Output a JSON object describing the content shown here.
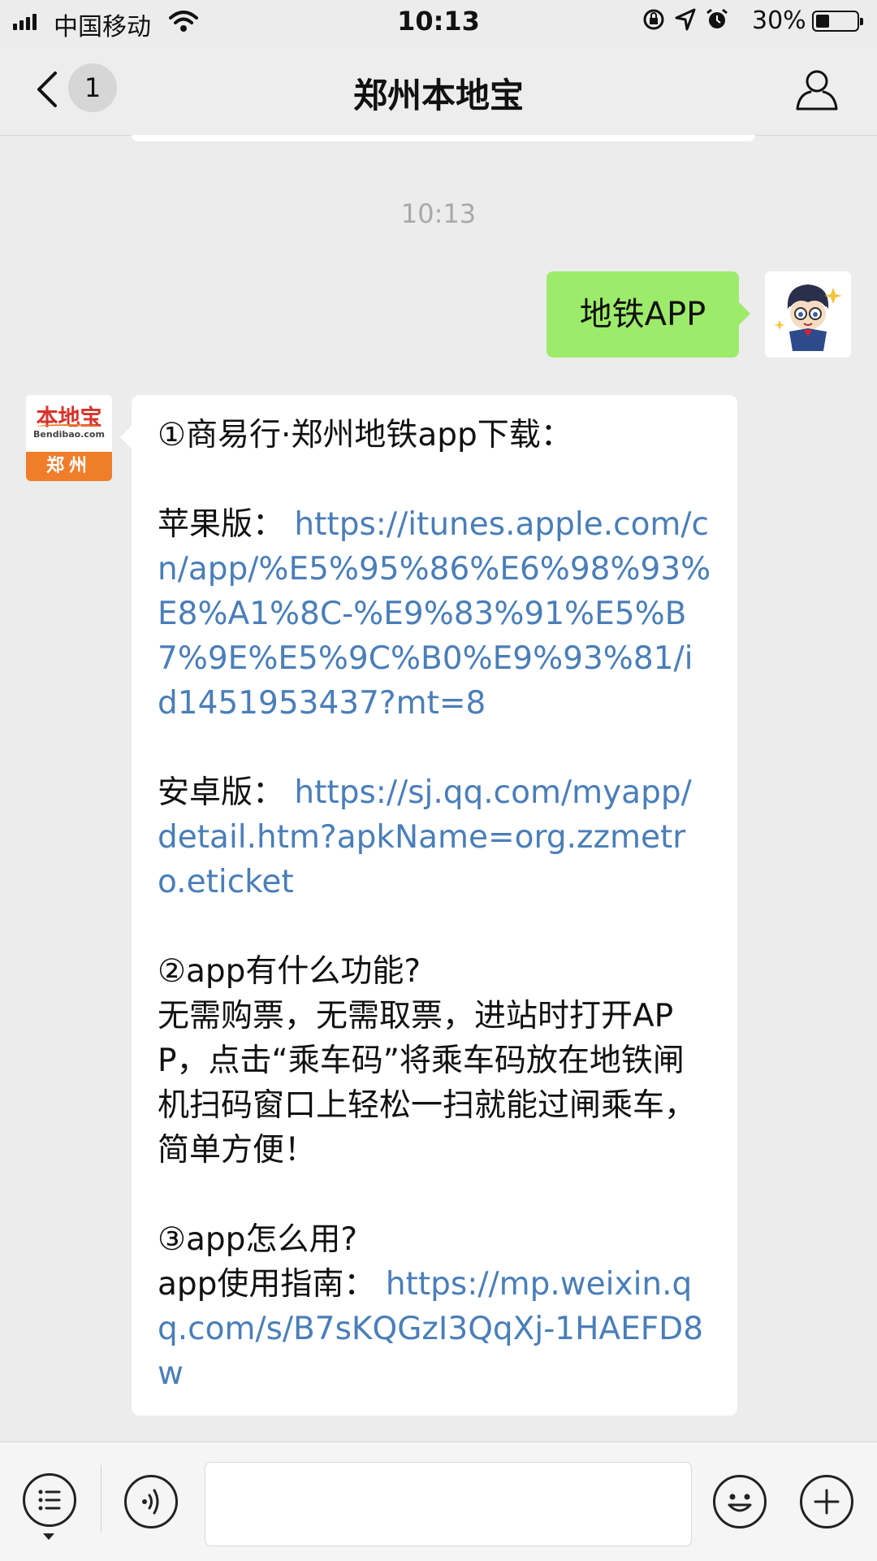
{
  "status_bar": {
    "carrier": "中国移动",
    "time": "10:13",
    "battery": "30%",
    "battery_level": 0.3,
    "icons": [
      "screen-rotation-lock-icon",
      "location-arrow-icon",
      "alarm-icon"
    ]
  },
  "nav": {
    "title": "郑州本地宝",
    "unread_count": "1"
  },
  "chat": {
    "timestamp": "10:13",
    "sent_message": "地铁APP",
    "received_avatar": {
      "logo_text": "本地宝",
      "domain": "Bendibao.com",
      "city": "郑州"
    },
    "received_message": {
      "s1_heading": "①商易行·郑州地铁app下载：",
      "apple_label": "苹果版：",
      "apple_link": "https://itunes.apple.com/cn/app/%E5%95%86%E6%98%93%E8%A1%8C-%E9%83%91%E5%B7%9E%E5%9C%B0%E9%93%81/id1451953437?mt=8",
      "android_label": "安卓版：",
      "android_link": "https://sj.qq.com/myapp/detail.htm?apkName=org.zzmetro.eticket",
      "s2_heading": "②app有什么功能?",
      "s2_body": "无需购票，无需取票，进站时打开APP，点击“乘车码”将乘车码放在地铁闸机扫码窗口上轻松一扫就能过闸乘车，简单方便！",
      "s3_heading": "③app怎么用?",
      "guide_label": "app使用指南：",
      "guide_link": "https://mp.weixin.qq.com/s/B7sKQGzI3QqXj-1HAEFD8w"
    }
  },
  "input_bar": {
    "icons": [
      "menu-list-icon",
      "voice-icon",
      "emoji-icon",
      "plus-icon"
    ],
    "text_value": ""
  }
}
